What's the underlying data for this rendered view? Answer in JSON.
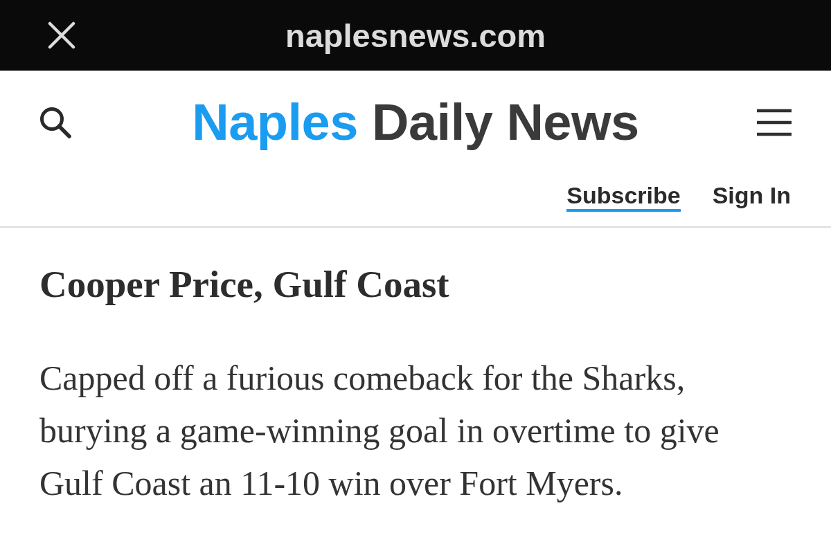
{
  "top_bar": {
    "domain": "naplesnews.com"
  },
  "header": {
    "logo": [
      {
        "text": "Naples",
        "kind": "accent"
      },
      {
        "text": "Daily News",
        "kind": "plain"
      }
    ],
    "links": [
      {
        "label": "Subscribe",
        "selected": true
      },
      {
        "label": "Sign In",
        "selected": false
      }
    ]
  },
  "article": {
    "heading": "Cooper Price, Gulf Coast",
    "body": "Capped off a furious comeback for the Sharks, burying a game-winning goal in overtime to give Gulf Coast an 11-10 win over Fort Myers."
  }
}
